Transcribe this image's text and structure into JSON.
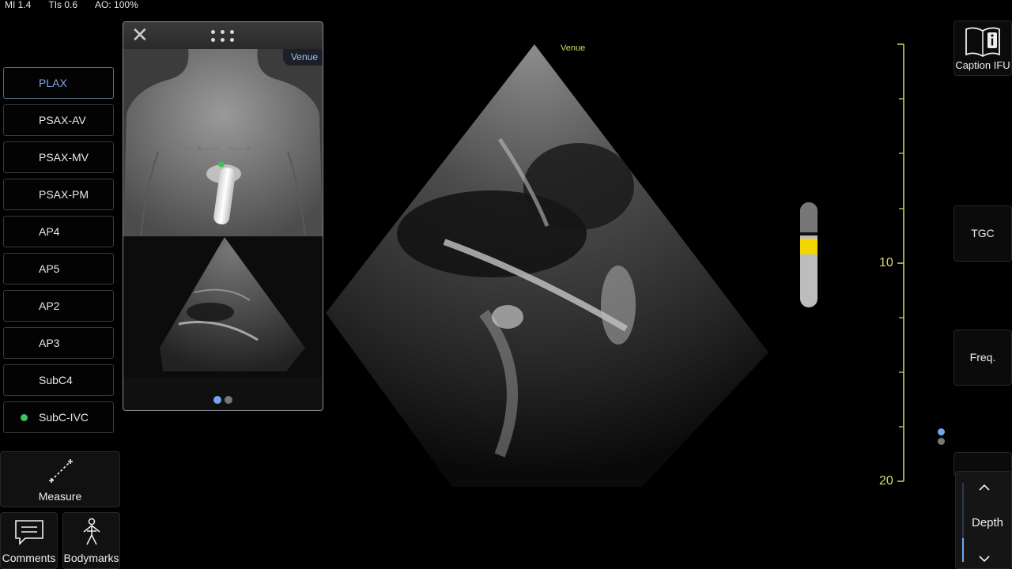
{
  "status": {
    "mi": "MI 1.4",
    "tis": "TIs 0.6",
    "ao": "AO: 100%"
  },
  "views": [
    {
      "label": "PLAX",
      "active": true
    },
    {
      "label": "PSAX-AV"
    },
    {
      "label": "PSAX-MV"
    },
    {
      "label": "PSAX-PM"
    },
    {
      "label": "AP4"
    },
    {
      "label": "AP5"
    },
    {
      "label": "AP2"
    },
    {
      "label": "AP3"
    },
    {
      "label": "SubC4"
    },
    {
      "label": "SubC-IVC",
      "status": "green"
    }
  ],
  "tools": {
    "measure": "Measure",
    "comments": "Comments",
    "bodymarks": "Bodymarks"
  },
  "guide": {
    "venue_tag": "Venue",
    "page": 1,
    "pages": 2
  },
  "image": {
    "venue_label": "Venue"
  },
  "depth_scale": {
    "ticks": [
      "10",
      "20"
    ]
  },
  "right_controls": {
    "caption_ifu": "Caption IFU",
    "tgc": "TGC",
    "freq": "Freq.",
    "depth": "Depth"
  },
  "gain_indicator": {
    "level": 0.48
  },
  "colors": {
    "accent": "#6fa8f0",
    "scale": "#d8d86a",
    "active_text": "#7fa6e6",
    "gain": "#f2d600",
    "status_green": "#3cc45a"
  },
  "icons": {
    "close": "close-icon",
    "drag": "drag-handle-icon",
    "measure": "caliper-icon",
    "comments": "comment-icon",
    "bodymarks": "body-icon",
    "ifu": "info-book-icon",
    "depth_up": "chevron-up-icon",
    "depth_down": "chevron-down-icon"
  }
}
